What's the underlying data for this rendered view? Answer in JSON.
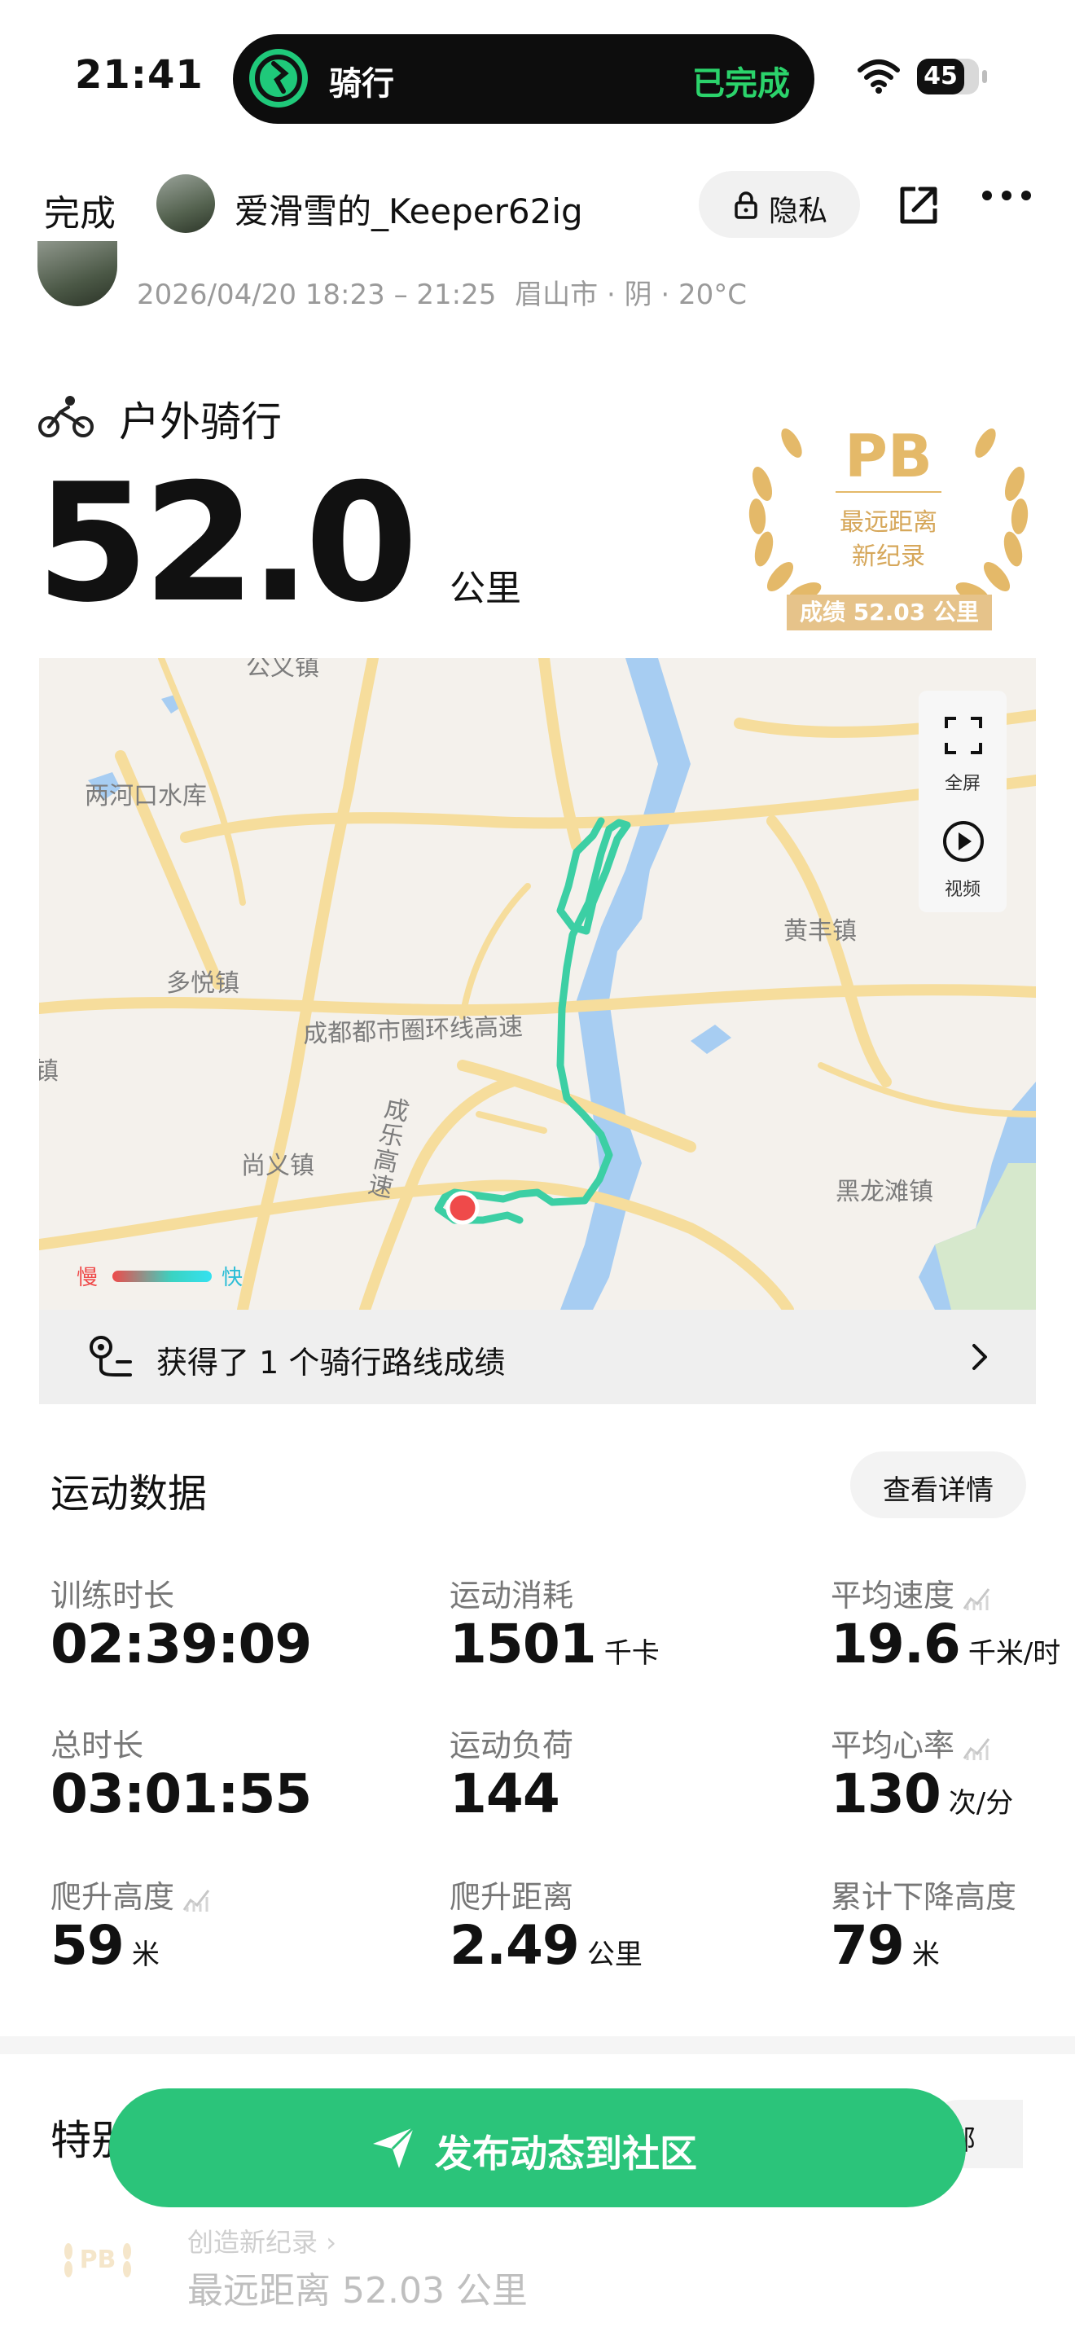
{
  "status_bar": {
    "time": "21:41",
    "battery": "45"
  },
  "island": {
    "title": "骑行",
    "status": "已完成"
  },
  "header": {
    "done_label": "完成",
    "username": "爱滑雪的_Keeper62ig",
    "privacy_label": "隐私"
  },
  "activity_meta": {
    "datetime": "2026/04/20 18:23 – 21:25",
    "location": "眉山市",
    "weather": "阴",
    "temperature": "20°C",
    "separator": " · "
  },
  "activity": {
    "type": "户外骑行",
    "distance": "52.0",
    "distance_unit": "公里"
  },
  "pb_badge": {
    "pb": "PB",
    "line1": "最远距离",
    "line2": "新纪录",
    "score": "成绩 52.03 公里"
  },
  "map": {
    "labels": {
      "reservoir": "两河口水库",
      "duoyue": "多悦镇",
      "ring": "成都都市圈环线高速",
      "zhen_left": "镇",
      "shangyi": "尚义镇",
      "chengle": "成乐高速",
      "huangfeng": "黄丰镇",
      "heilongtan": "黑龙滩镇",
      "top_cut": "公义镇"
    },
    "fullscreen_label": "全屏",
    "video_label": "视频",
    "legend_slow": "慢",
    "legend_fast": "快",
    "route_color": "#3ccfa4",
    "start_color": "#ef4a4a"
  },
  "route_achievement": {
    "text": "获得了 1 个骑行路线成绩"
  },
  "sport_data": {
    "title": "运动数据",
    "detail_label": "查看详情",
    "stats": [
      {
        "label": "训练时长",
        "value": "02:39:09",
        "unit": ""
      },
      {
        "label": "运动消耗",
        "value": "1501",
        "unit": "千卡"
      },
      {
        "label": "平均速度",
        "value": "19.6",
        "unit": "千米/时"
      },
      {
        "label": "总时长",
        "value": "03:01:55",
        "unit": ""
      },
      {
        "label": "运动负荷",
        "value": "144",
        "unit": ""
      },
      {
        "label": "平均心率",
        "value": "130",
        "unit": "次/分"
      },
      {
        "label": "爬升高度",
        "value": "59",
        "unit": "米"
      },
      {
        "label": "爬升距离",
        "value": "2.49",
        "unit": "公里"
      },
      {
        "label": "累计下降高度",
        "value": "79",
        "unit": "米"
      }
    ]
  },
  "special": {
    "title": "特别",
    "all_label": "部",
    "record_link": "创造新纪录",
    "record_value": "最远距离 52.03 公里"
  },
  "cta": {
    "label": "发布动态到社区"
  },
  "colors": {
    "accent_green": "#2bc47a",
    "pb_gold": "#e6c38a"
  }
}
